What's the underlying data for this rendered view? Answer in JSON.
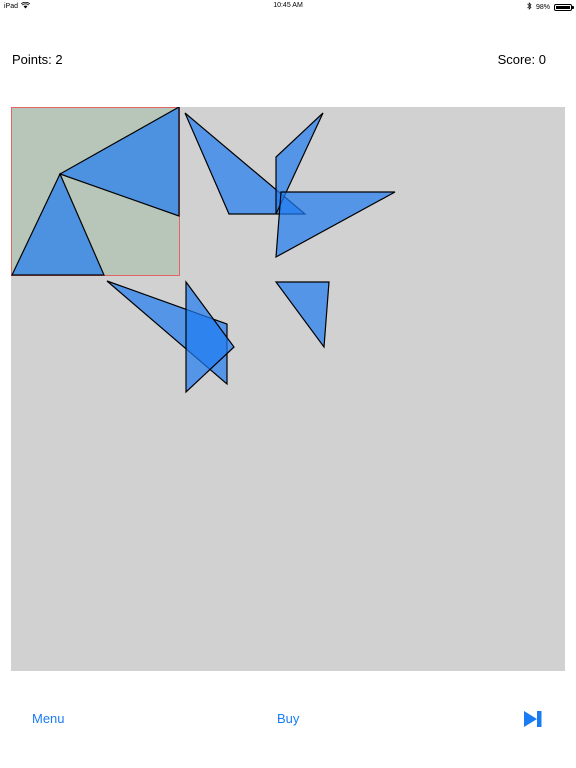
{
  "status_bar": {
    "device": "iPad",
    "time": "10:45 AM",
    "battery": "98%",
    "battery_level": 0.98,
    "icons": [
      "wifi-icon",
      "bluetooth-icon",
      "battery-icon"
    ]
  },
  "header": {
    "points_text": "Points: 2",
    "score_text": "Score: 0"
  },
  "board": {
    "background": "#d1d1d1",
    "target_fill": "#b7c6b9",
    "target_border": "#e06666",
    "piece_fill": "#1f7cf2",
    "piece_opacity": 0.7,
    "piece_stroke": "#000000"
  },
  "footer": {
    "menu_label": "Menu",
    "buy_label": "Buy",
    "next_icon": "skip-forward-icon",
    "link_color": "#1a7cf5"
  }
}
